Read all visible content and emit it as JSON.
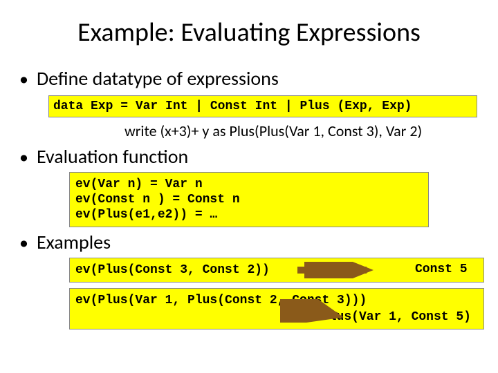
{
  "title": "Example: Evaluating Expressions",
  "bullets": {
    "b1": "Define datatype of expressions",
    "b2": "Evaluation function",
    "b3": "Examples"
  },
  "code": {
    "datatype": "data Exp = Var Int | Const Int | Plus (Exp, Exp)",
    "note": "write (x+3)+ y as Plus(Plus(Var 1, Const 3), Var 2)",
    "ev1": "ev(Var n) = Var n",
    "ev2": "ev(Const n ) = Const n",
    "ev3": "ev(Plus(e1,e2)) = …",
    "ex1": "ev(Plus(Const 3, Const 2))",
    "ex1res": "Const 5",
    "ex2": "ev(Plus(Var 1, Plus(Const 2, Const 3)))",
    "ex2res": "Plus(Var 1, Const 5)"
  }
}
